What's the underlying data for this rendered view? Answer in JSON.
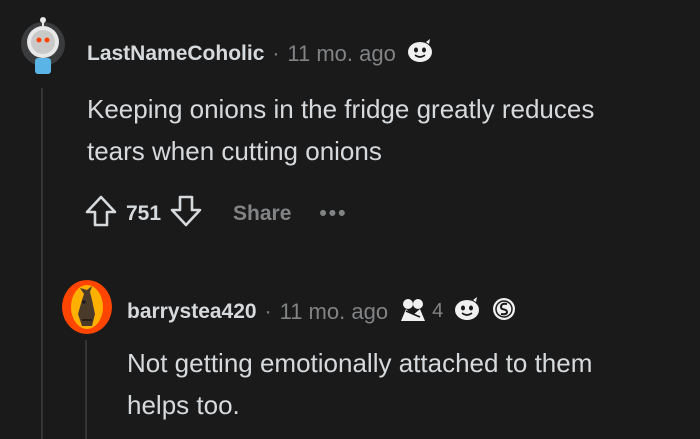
{
  "comments": [
    {
      "author": "LastNameCoholic",
      "separator": "·",
      "age": "11 mo. ago",
      "avatar_icon": "astronaut-snoo-avatar-icon",
      "awards": [
        {
          "icon": "wholesome-award-icon"
        }
      ],
      "body_lines": [
        "Keeping onions in the fridge greatly reduces",
        "tears when cutting onions"
      ],
      "votes": "751",
      "share_label": "Share",
      "more_label": "•••"
    },
    {
      "author": "barrystea420",
      "separator": "·",
      "age": "11 mo. ago",
      "avatar_icon": "horse-head-avatar-icon",
      "awards": [
        {
          "icon": "hugz-award-icon",
          "count": "4"
        },
        {
          "icon": "wholesome-award-icon"
        },
        {
          "icon": "silver-award-icon"
        }
      ],
      "body_lines": [
        "Not getting emotionally attached to them",
        "helps too."
      ]
    }
  ],
  "colors": {
    "background": "#1a1a1b",
    "text": "#d7dadc",
    "muted": "#818384",
    "thread_line": "#343536"
  }
}
